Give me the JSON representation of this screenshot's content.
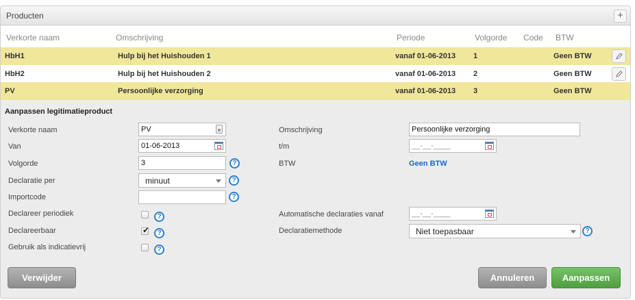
{
  "panel": {
    "title": "Producten",
    "add_label": "+"
  },
  "table": {
    "columns": [
      "Verkorte naam",
      "Omschrijving",
      "Periode",
      "Volgorde",
      "Code",
      "BTW"
    ],
    "rows": [
      {
        "short": "HbH1",
        "desc": "Hulp bij het Huishouden 1",
        "period": "vanaf 01-06-2013",
        "order": "1",
        "code": "",
        "btw": "Geen BTW"
      },
      {
        "short": "HbH2",
        "desc": "Hulp bij het Huishouden 2",
        "period": "vanaf 01-06-2013",
        "order": "2",
        "code": "",
        "btw": "Geen BTW"
      },
      {
        "short": "PV",
        "desc": "Persoonlijke verzorging",
        "period": "vanaf 01-06-2013",
        "order": "3",
        "code": "",
        "btw": "Geen BTW"
      }
    ]
  },
  "form": {
    "title": "Aanpassen legitimatieproduct",
    "labels": {
      "short_name": "Verkorte naam",
      "from": "Van",
      "order": "Volgorde",
      "declare_per": "Declaratie per",
      "import_code": "Importcode",
      "declare_periodic": "Declareer periodiek",
      "declarable": "Declareerbaar",
      "indication_free": "Gebruik als indicatievrij",
      "description": "Omschrijving",
      "until": "t/m",
      "btw": "BTW",
      "auto_declarations_from": "Automatische declaraties vanaf",
      "declaration_method": "Declaratiemethode"
    },
    "values": {
      "short_name": "PV",
      "from": "01-06-2013",
      "order": "3",
      "declare_per": "minuut",
      "import_code": "",
      "description": "Persoonlijke verzorging",
      "until": "__-__-____",
      "btw": "Geen BTW",
      "auto_declarations_from": "__-__-____",
      "declaration_method": "Niet toepasbaar",
      "declare_periodic_checked": false,
      "declarable_checked": true,
      "indication_free_checked": false
    },
    "check_mark": "✔",
    "help_glyph": "?"
  },
  "buttons": {
    "delete": "Verwijder",
    "cancel": "Annuleren",
    "save": "Aanpassen"
  },
  "colors": {
    "highlight_row": "#f1e79a",
    "link": "#1b66c9",
    "primary": "#4f9e40"
  }
}
